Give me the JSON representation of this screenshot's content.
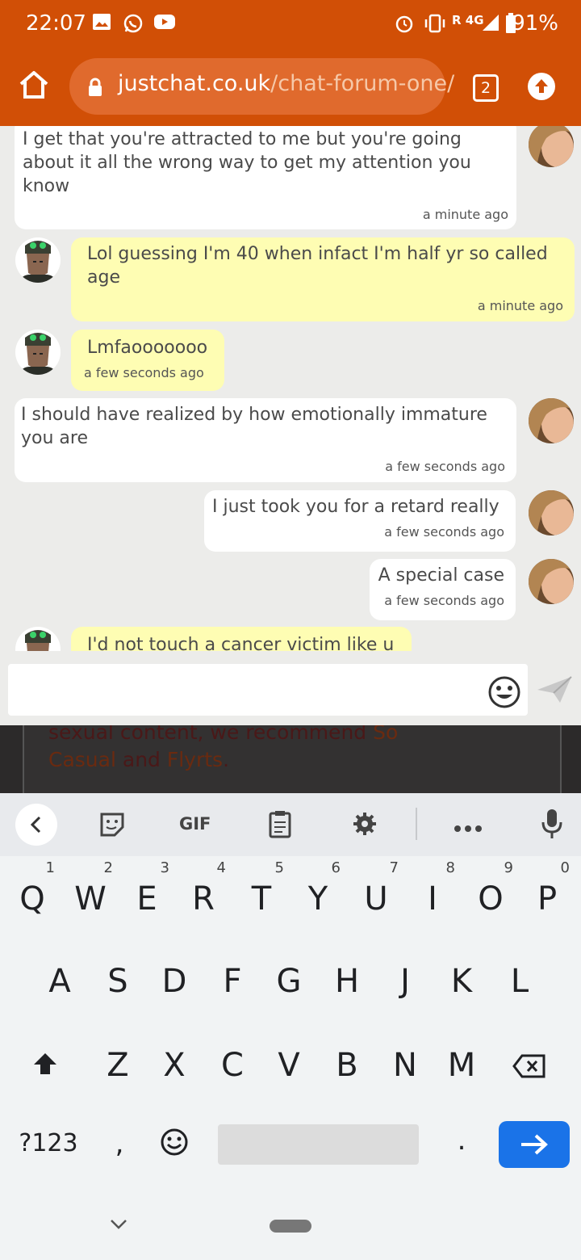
{
  "status_bar": {
    "time": "22:07",
    "network": "R 4G",
    "battery": "91%"
  },
  "browser": {
    "url_host": "justchat.co.uk",
    "url_path": "/chat-forum-one/",
    "tab_count": "2"
  },
  "messages": [
    {
      "sender": "self",
      "text": "I get that you're attracted to me but you're going about it all the wrong way to get my attention you know",
      "time": "a minute ago"
    },
    {
      "sender": "other",
      "text": "Lol guessing I'm 40 when infact I'm half yr so called age",
      "time": "a minute ago"
    },
    {
      "sender": "other",
      "text": "Lmfaooooooo",
      "time": "a few seconds ago"
    },
    {
      "sender": "self",
      "text": "I should have realized by how emotionally immature you are",
      "time": "a few seconds ago"
    },
    {
      "sender": "self",
      "text": "I just took you for a retard really",
      "time": "a few seconds ago"
    },
    {
      "sender": "self",
      "text": "A special case",
      "time": "a few seconds ago"
    },
    {
      "sender": "other",
      "text": "I'd not touch a cancer victim like u",
      "time": ""
    }
  ],
  "background_page": {
    "line1": "sexual content, we recommend ",
    "link1a": "So",
    "link1b": "Casual",
    "and": " and ",
    "link2": "Flyrts",
    "period": "."
  },
  "keyboard": {
    "toolbar_gif": "GIF",
    "row1": [
      "Q",
      "W",
      "E",
      "R",
      "T",
      "Y",
      "U",
      "I",
      "O",
      "P"
    ],
    "row1_hints": [
      "1",
      "2",
      "3",
      "4",
      "5",
      "6",
      "7",
      "8",
      "9",
      "0"
    ],
    "row2": [
      "A",
      "S",
      "D",
      "F",
      "G",
      "H",
      "J",
      "K",
      "L"
    ],
    "row3": [
      "Z",
      "X",
      "C",
      "V",
      "B",
      "N",
      "M"
    ],
    "symbols_key": "?123",
    "comma_key": ",",
    "period_key": "."
  },
  "colors": {
    "brand_orange": "#d14f06",
    "own_bubble": "#ffffff",
    "other_bubble": "#fefdb3",
    "enter_key": "#1a73e8"
  }
}
